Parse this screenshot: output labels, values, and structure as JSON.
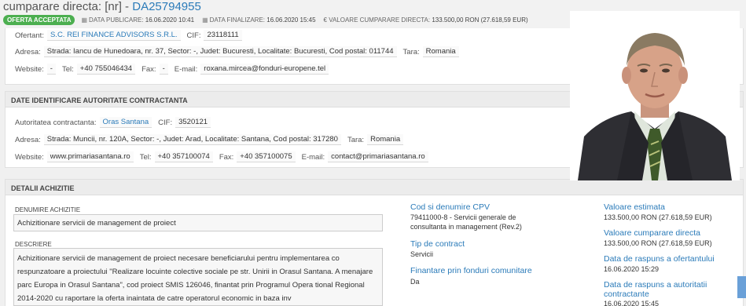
{
  "header": {
    "title_prefix": "cumparare directa: [nr] - ",
    "title_code": "DA25794955",
    "badge": "OFERTA ACCEPTATA",
    "data_publicare_label": "DATA PUBLICARE:",
    "data_publicare": "16.06.2020 10:41",
    "data_finalizare_label": "DATA FINALIZARE:",
    "data_finalizare": "16.06.2020 15:45",
    "valoare_label": "€ VALOARE CUMPARARE DIRECTA:",
    "valoare": "133.500,00  RON (27.618,59  EUR)"
  },
  "ofertant": {
    "label": "Ofertant:",
    "name": "S.C. REI FINANCE ADVISORS S.R.L.",
    "cif_label": "CIF:",
    "cif": "23118111",
    "adresa_label": "Adresa:",
    "adresa": "Strada: Iancu de Hunedoara, nr. 37, Sector: -, Judet: Bucuresti, Localitate: Bucuresti, Cod postal: 011744",
    "tara_label": "Tara:",
    "tara": "Romania",
    "website_label": "Website:",
    "website": "-",
    "tel_label": "Tel:",
    "tel": "+40 755046434",
    "fax_label": "Fax:",
    "fax": "-",
    "email_label": "E-mail:",
    "email": "roxana.mircea@fonduri-europene.tel"
  },
  "autoritate": {
    "heading": "DATE IDENTIFICARE AUTORITATE CONTRACTANTA",
    "label": "Autoritatea contractanta:",
    "name": "Oras Santana",
    "cif_label": "CIF:",
    "cif": "3520121",
    "adresa_label": "Adresa:",
    "adresa": "Strada: Muncii, nr. 120A, Sector: -, Judet: Arad, Localitate: Santana, Cod postal: 317280",
    "tara_label": "Tara:",
    "tara": "Romania",
    "website_label": "Website:",
    "website": "www.primariasantana.ro",
    "tel_label": "Tel:",
    "tel": "+40 357100074",
    "fax_label": "Fax:",
    "fax": "+40 357100075",
    "email_label": "E-mail:",
    "email": "contact@primariasantana.ro"
  },
  "detalii": {
    "heading": "DETALII ACHIZITIE",
    "denumire_label": "DENUMIRE ACHIZITIE",
    "denumire": "Achizitionare servicii de management de proiect",
    "descriere_label": "DESCRIERE",
    "descriere": "Achizitionare servicii de management de proiect necesare beneficiarului pentru implementarea co respunzatoare a proiectului \"Realizare locuinte colective sociale pe str. Unirii in Orasul Santana. A menajare parc Europa in Orasul Santana\", cod proiect SMIS 126046, finantat prin Programul Opera tional Regional 2014-2020 cu raportare la oferta inaintata de catre operatorul economic in baza inv",
    "cpv_label": "Cod si denumire CPV",
    "cpv": "79411000-8 - Servicii generale de consultanta in management (Rev.2)",
    "tip_label": "Tip de contract",
    "tip": "Servicii",
    "fonduri_label": "Finantare prin fonduri comunitare",
    "fonduri": "Da",
    "val_estimata_label": "Valoare estimata",
    "val_estimata": "133.500,00  RON (27.618,59  EUR)",
    "val_cumparare_label": "Valoare cumparare directa",
    "val_cumparare": "133.500,00  RON (27.618,59  EUR)",
    "data_raspuns_ofertant_label": "Data de raspuns a ofertantului",
    "data_raspuns_ofertant": "16.06.2020 15:29",
    "data_raspuns_autoritate_label": "Data de raspuns a autoritatii contractante",
    "data_raspuns_autoritate": "16.06.2020 15:45"
  }
}
